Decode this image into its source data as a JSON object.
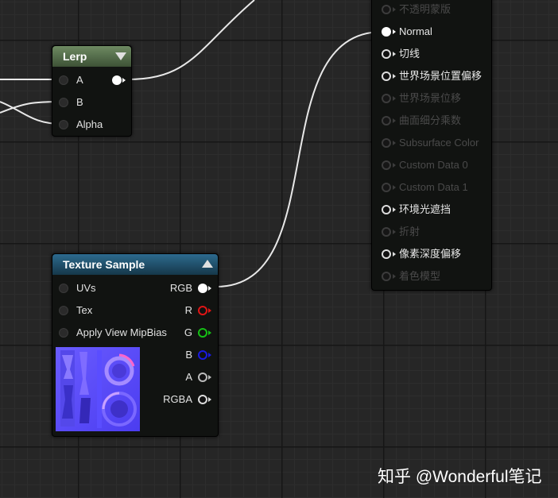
{
  "lerp_node": {
    "title": "Lerp",
    "inputs": [
      "A",
      "B",
      "Alpha"
    ]
  },
  "texture_node": {
    "title": "Texture Sample",
    "inputs": [
      "UVs",
      "Tex",
      "Apply View MipBias"
    ],
    "outputs": [
      {
        "label": "RGB",
        "color": "#ffffff"
      },
      {
        "label": "R",
        "color": "#e01515"
      },
      {
        "label": "G",
        "color": "#15c015"
      },
      {
        "label": "B",
        "color": "#1a1ae0"
      },
      {
        "label": "A",
        "color": "#bbbbbb"
      },
      {
        "label": "RGBA",
        "color": "#dddddd"
      }
    ]
  },
  "material_result": {
    "pins": [
      {
        "label": "不透明蒙版",
        "enabled": false
      },
      {
        "label": "Normal",
        "enabled": true,
        "connected": true
      },
      {
        "label": "切线",
        "enabled": true
      },
      {
        "label": "世界场景位置偏移",
        "enabled": true
      },
      {
        "label": "世界场景位移",
        "enabled": false
      },
      {
        "label": "曲面细分乘数",
        "enabled": false
      },
      {
        "label": "Subsurface Color",
        "enabled": false
      },
      {
        "label": "Custom Data 0",
        "enabled": false
      },
      {
        "label": "Custom Data 1",
        "enabled": false
      },
      {
        "label": "环境光遮挡",
        "enabled": true
      },
      {
        "label": "折射",
        "enabled": false
      },
      {
        "label": "像素深度偏移",
        "enabled": true
      },
      {
        "label": "着色模型",
        "enabled": false
      }
    ]
  },
  "watermark": "知乎 @Wonderful笔记"
}
